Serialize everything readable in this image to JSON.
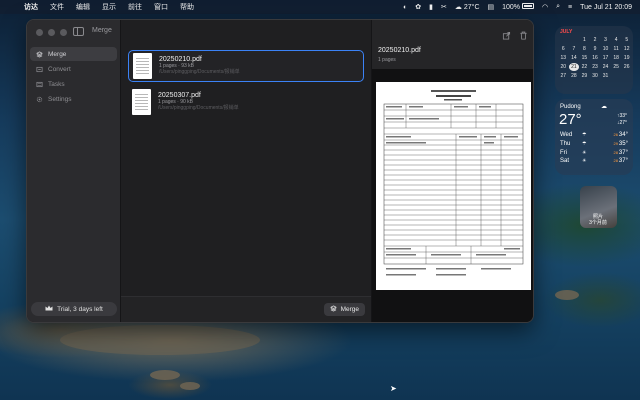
{
  "menubar": {
    "apple_icon": "apple-icon",
    "items": [
      "访达",
      "文件",
      "编辑",
      "显示",
      "前往",
      "窗口",
      "帮助"
    ],
    "weather": "27°C",
    "battery": "100%",
    "datetime": "Tue Jul 21 20:09"
  },
  "window": {
    "title": "Merge",
    "nav": [
      {
        "label": "Merge",
        "icon": "stack-icon",
        "active": true
      },
      {
        "label": "Convert",
        "icon": "convert-icon",
        "active": false
      },
      {
        "label": "Tasks",
        "icon": "tasks-icon",
        "active": false
      },
      {
        "label": "Settings",
        "icon": "gear-icon",
        "active": false
      }
    ],
    "trial_label": "Trial, 3 days left",
    "files": [
      {
        "name": "20250210.pdf",
        "meta": "1 pages · 93 kB",
        "path": "/Users/pinggping/Documents/报销单",
        "selected": true
      },
      {
        "name": "20250307.pdf",
        "meta": "1 pages · 90 kB",
        "path": "/Users/pinggping/Documents/报销单",
        "selected": false
      }
    ],
    "merge_button": "Merge",
    "preview": {
      "title": "20250210.pdf",
      "subtitle": "1 pages"
    }
  },
  "calendar": {
    "month": "JULY",
    "days": [
      "",
      "",
      "1",
      "2",
      "3",
      "4",
      "5",
      "6",
      "7",
      "8",
      "9",
      "10",
      "11",
      "12",
      "13",
      "14",
      "15",
      "16",
      "17",
      "18",
      "19",
      "20",
      "21",
      "22",
      "23",
      "24",
      "25",
      "26",
      "27",
      "28",
      "29",
      "30",
      "31",
      "",
      ""
    ],
    "today": "21"
  },
  "weather": {
    "city": "Pudong",
    "temp": "27°",
    "hi": "↑33°",
    "lo": "↓27°",
    "forecast": [
      {
        "day": "Wed",
        "icon": "rain-icon",
        "lo": "26",
        "hi": "34°"
      },
      {
        "day": "Thu",
        "icon": "rain-icon",
        "lo": "29",
        "hi": "35°"
      },
      {
        "day": "Fri",
        "icon": "sun-icon",
        "lo": "28",
        "hi": "37°"
      },
      {
        "day": "Sat",
        "icon": "sun-icon",
        "lo": "28",
        "hi": "37°"
      }
    ]
  },
  "photo": {
    "caption": "照片\n3个月前"
  }
}
